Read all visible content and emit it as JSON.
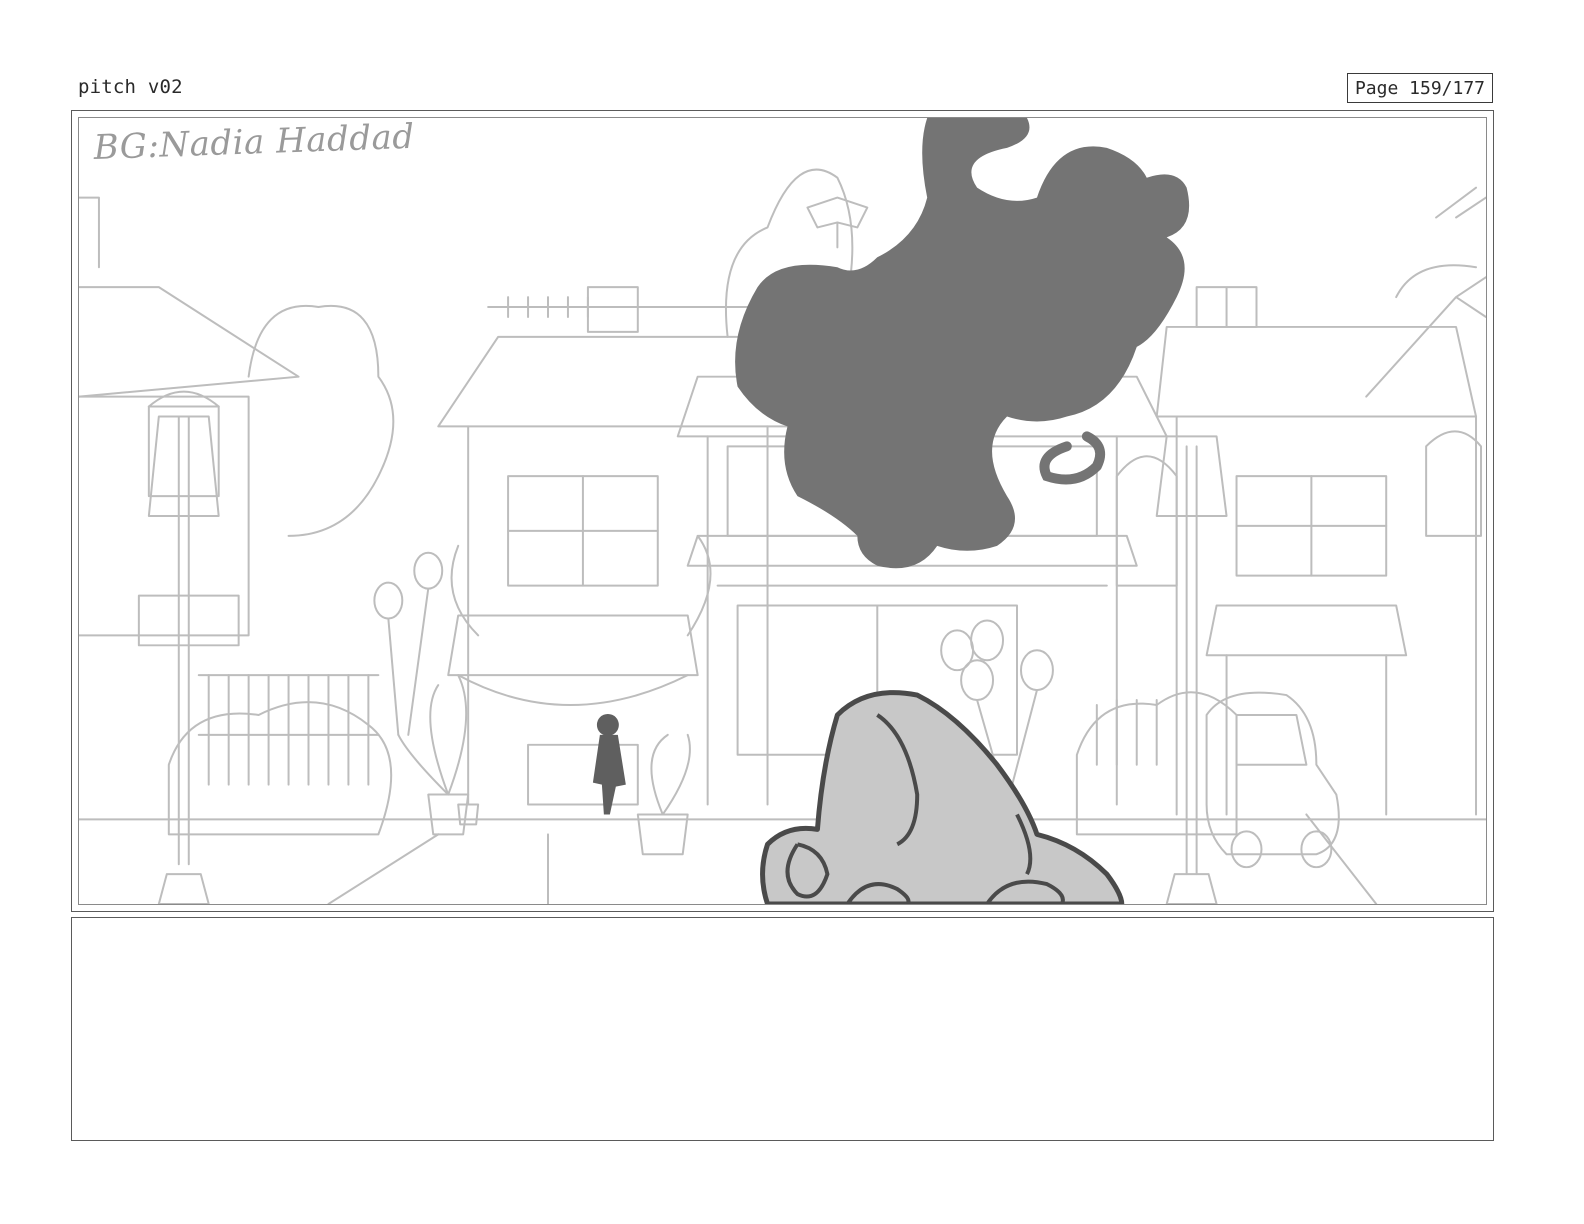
{
  "header": {
    "title": "pitch v02",
    "page_label": "Page 159/177"
  },
  "panel": {
    "bg_credit": "BG:Nadia Haddad"
  },
  "notes": {
    "text": ""
  },
  "colors": {
    "sketch_line": "#b9b9b9",
    "shadow_silhouette": "#747474",
    "foreground_shape": "#c8c8c8",
    "foreground_outline": "#4a4a4a"
  },
  "icons": {
    "scene": "storyboard-sketch-illustration"
  }
}
